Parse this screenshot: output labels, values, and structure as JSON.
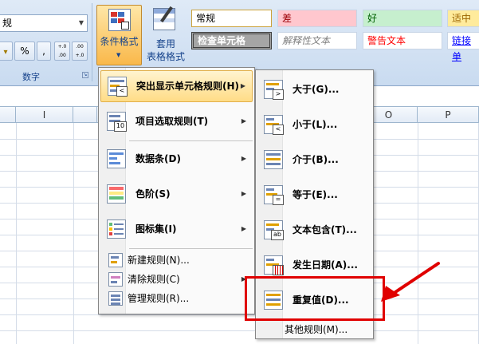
{
  "ribbon": {
    "number_format_value": "规",
    "percent_label": "%",
    "comma_label": ",",
    "inc_decimal_label": "+.0 .00",
    "dec_decimal_label": ".00 +.0",
    "number_group_label": "数字",
    "conditional_format_label": "条件格式",
    "table_format_label_1": "套用",
    "table_format_label_2": "表格格式",
    "styles": {
      "normal": "常规",
      "bad": "差",
      "good": "好",
      "neutral": "适中",
      "check_cell": "检查单元格",
      "explanatory": "解释性文本",
      "warning": "警告文本",
      "link": "链接单"
    }
  },
  "sheet": {
    "col_i": "I",
    "col_o": "O",
    "col_p": "P"
  },
  "cf_menu": {
    "items": [
      {
        "label": "突出显示单元格规则(H)"
      },
      {
        "label": "项目选取规则(T)"
      },
      {
        "label": "数据条(D)"
      },
      {
        "label": "色阶(S)"
      },
      {
        "label": "图标集(I)"
      },
      {
        "label": "新建规则(N)..."
      },
      {
        "label": "清除规则(C)"
      },
      {
        "label": "管理规则(R)..."
      }
    ]
  },
  "sub_menu": {
    "items": [
      {
        "label": "大于(G)..."
      },
      {
        "label": "小于(L)..."
      },
      {
        "label": "介于(B)..."
      },
      {
        "label": "等于(E)..."
      },
      {
        "label": "文本包含(T)..."
      },
      {
        "label": "发生日期(A)..."
      },
      {
        "label": "重复值(D)..."
      },
      {
        "label": "其他规则(M)..."
      }
    ]
  },
  "icon_texts": {
    "top10": "10",
    "gt": ">",
    "lt": "<",
    "eq": "=",
    "ab": "ab"
  },
  "colors": {
    "highlight": "#ffdc86",
    "annotation_red": "#e00000"
  }
}
